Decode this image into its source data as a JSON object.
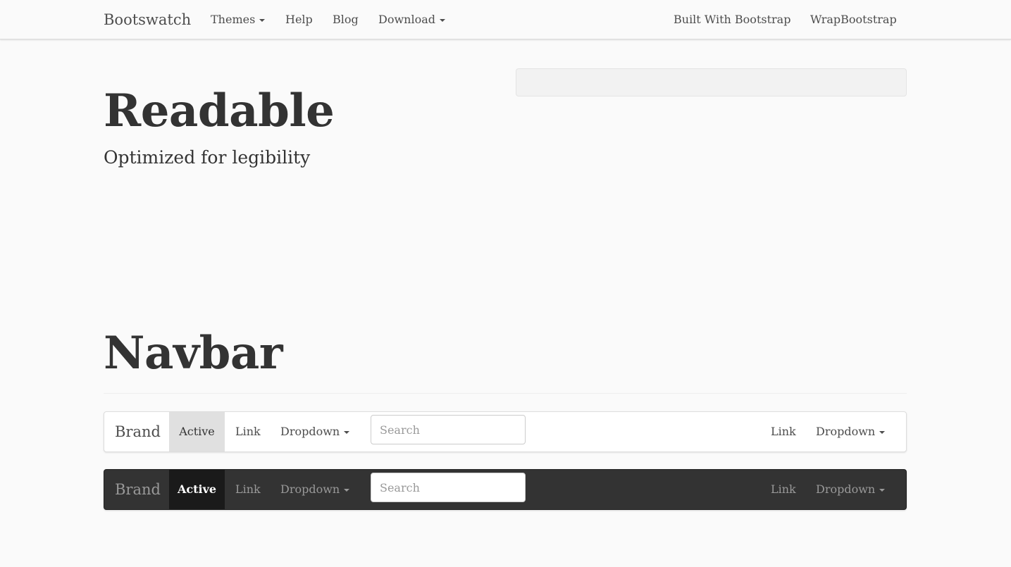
{
  "topbar": {
    "brand": "Bootswatch",
    "left_items": [
      "Themes",
      "Help",
      "Blog",
      "Download"
    ],
    "right_items": [
      "Built With Bootstrap",
      "WrapBootstrap"
    ]
  },
  "header": {
    "title": "Readable",
    "subtitle": "Optimized for legibility"
  },
  "section": {
    "title": "Navbar"
  },
  "demo_navbar_light": {
    "brand": "Brand",
    "active": "Active",
    "link": "Link",
    "dropdown": "Dropdown",
    "search_placeholder": "Search",
    "right_link": "Link",
    "right_dropdown": "Dropdown"
  },
  "demo_navbar_dark": {
    "brand": "Brand",
    "active": "Active",
    "link": "Link",
    "dropdown": "Dropdown",
    "search_placeholder": "Search",
    "right_link": "Link",
    "right_dropdown": "Dropdown"
  },
  "colors": {
    "background": "#fafafa",
    "text": "#333333",
    "dark_navbar": "#333333",
    "active_light": "#e0e0e0",
    "active_dark": "#1a1a1a"
  },
  "icons": [
    "caret-down-icon"
  ]
}
